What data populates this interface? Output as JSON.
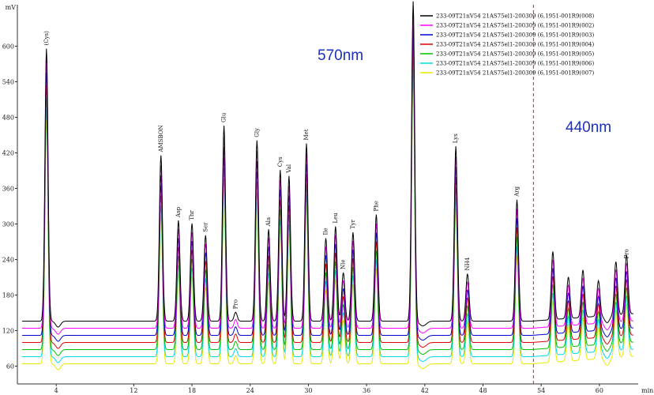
{
  "chart_data": {
    "type": "line",
    "ylabel": "mV",
    "xlabel": "min",
    "xlim": [
      0,
      64
    ],
    "ylim": [
      30,
      670
    ],
    "x_ticks": [
      4,
      12,
      18,
      24,
      30,
      36,
      42,
      48,
      54,
      60
    ],
    "y_ticks": [
      60,
      120,
      180,
      240,
      300,
      360,
      420,
      480,
      540,
      600
    ],
    "wavelength_labels": {
      "left": "570nm",
      "right": "440nm",
      "color": "#1c2fbf"
    },
    "split_line": {
      "x": 53.2,
      "color": "#d92020"
    },
    "series": [
      {
        "name": "233-09T21nV54 21AS75el1-200309 (6,1951-001R9(008)",
        "color": "#000000",
        "offset": 0
      },
      {
        "name": "233-09T21nV54 21AS75el1-200309 (6,1951-001R9(002)",
        "color": "#ff00ff",
        "offset": -12
      },
      {
        "name": "233-09T21nV54 21AS75el1-200309 (6,1951-001R9(003)",
        "color": "#0000d0",
        "offset": -24
      },
      {
        "name": "233-09T21nV54 21AS75el1-200309 (6,1951-001R9(004)",
        "color": "#e00000",
        "offset": -36
      },
      {
        "name": "233-09T21nV54 21AS75el1-200309 (6,1951-001R9(005)",
        "color": "#00c000",
        "offset": -48
      },
      {
        "name": "233-09T21nV54 21AS75el1-200309 (6,1951-001R9(006)",
        "color": "#00d8e8",
        "offset": -60
      },
      {
        "name": "233-09T21nV54 21AS75el1-200309 (6,1951-001R9(007)",
        "color": "#e8e800",
        "offset": -72
      }
    ],
    "baseline": 136,
    "peaks": [
      {
        "name": "(Cys)",
        "x": 3.0,
        "height": 460
      },
      {
        "name": "AMSBON",
        "x": 14.8,
        "height": 280
      },
      {
        "name": "Asp",
        "x": 16.6,
        "height": 170
      },
      {
        "name": "Thr",
        "x": 18.0,
        "height": 165
      },
      {
        "name": "Ser",
        "x": 19.4,
        "height": 145
      },
      {
        "name": "Glu",
        "x": 21.3,
        "height": 330
      },
      {
        "name": "Pro",
        "x": 22.5,
        "height": 15
      },
      {
        "name": "Gly",
        "x": 24.7,
        "height": 305
      },
      {
        "name": "Ala",
        "x": 25.9,
        "height": 155
      },
      {
        "name": "Cys",
        "x": 27.1,
        "height": 255
      },
      {
        "name": "Val",
        "x": 28.0,
        "height": 245
      },
      {
        "name": "Met",
        "x": 29.8,
        "height": 300
      },
      {
        "name": "Ile",
        "x": 31.8,
        "height": 140
      },
      {
        "name": "Leu",
        "x": 32.8,
        "height": 160
      },
      {
        "name": "Nle",
        "x": 33.6,
        "height": 82
      },
      {
        "name": "Tyr",
        "x": 34.6,
        "height": 150
      },
      {
        "name": "Phe",
        "x": 37.0,
        "height": 180
      },
      {
        "name": "",
        "x": 40.8,
        "height": 540
      },
      {
        "name": "Lys",
        "x": 45.2,
        "height": 295
      },
      {
        "name": "NH4",
        "x": 46.4,
        "height": 80
      },
      {
        "name": "Arg",
        "x": 51.5,
        "height": 205
      },
      {
        "name": "",
        "x": 55.2,
        "height": 115
      },
      {
        "name": "",
        "x": 56.8,
        "height": 70
      },
      {
        "name": "",
        "x": 58.3,
        "height": 80
      },
      {
        "name": "",
        "x": 59.9,
        "height": 60
      },
      {
        "name": "",
        "x": 61.7,
        "height": 90
      },
      {
        "name": "Pro",
        "x": 62.8,
        "height": 100
      }
    ]
  }
}
